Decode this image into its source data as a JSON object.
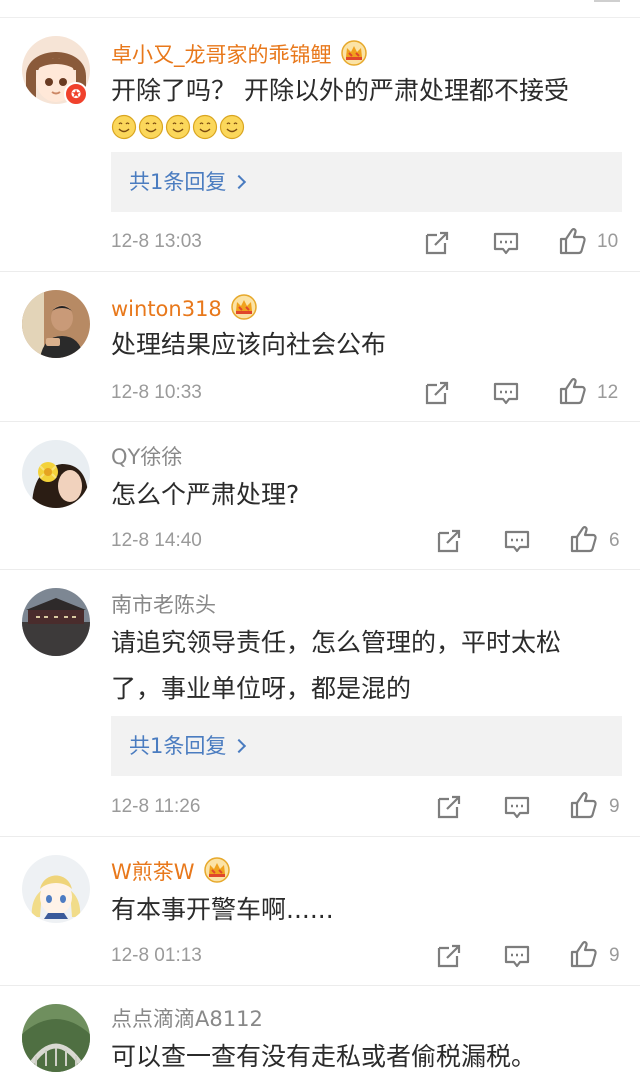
{
  "comments": [
    {
      "name": "卓小又_龙哥家的乖锦鲤",
      "name_style": "vip",
      "text": "开除了吗？ 开除以外的严肃处理都不接受",
      "emoji_count": 5,
      "emoji_icon": "smile-emoji-icon",
      "reply_label": "共1条回复",
      "time": "12-8 13:03",
      "likes": "10"
    },
    {
      "name": "winton318",
      "name_style": "vip",
      "text": "处理结果应该向社会公布",
      "time": "12-8 10:33",
      "likes": "12"
    },
    {
      "name": "QY徐徐",
      "name_style": "plain",
      "text": "怎么个严肃处理?",
      "time": "12-8 14:40",
      "likes": "6"
    },
    {
      "name": "南市老陈头",
      "name_style": "plain",
      "text_line1": "请追究领导责任，怎么管理的，平时太松",
      "text_line2": "了，事业单位呀，都是混的",
      "reply_label": "共1条回复",
      "time": "12-8 11:26",
      "likes": "9"
    },
    {
      "name": "W煎茶W",
      "name_style": "vip",
      "text": "有本事开警车啊......",
      "time": "12-8 01:13",
      "likes": "9"
    },
    {
      "name": "点点滴滴A8112",
      "name_style": "plain",
      "text": "可以查一查有没有走私或者偷税漏税。"
    }
  ],
  "icons": {
    "vip": "crown-icon",
    "share": "share-icon",
    "comment": "comment-icon",
    "like": "thumbs-up-icon",
    "verified": "verified-badge-icon"
  },
  "colors": {
    "vip_name": "#e8781b",
    "plain_name": "#888888",
    "reply_link": "#4a7cc0",
    "reply_bg": "#f2f2f2",
    "meta": "#9a9a9a"
  }
}
